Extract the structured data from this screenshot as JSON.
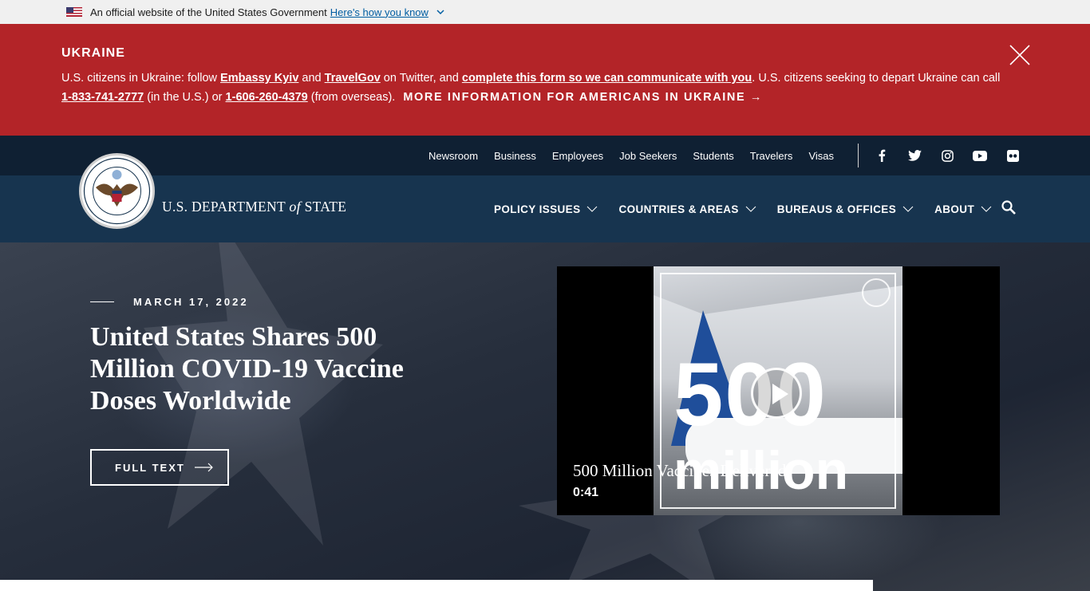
{
  "gov_banner": {
    "text": "An official website of the United States Government",
    "link": "Here's how you know"
  },
  "alert": {
    "title": "UKRAINE",
    "line_parts": {
      "p1": "U.S. citizens in Ukraine: follow ",
      "embassy": "Embassy Kyiv",
      "p2": " and ",
      "travelgov": "TravelGov",
      "p3": " on Twitter, and ",
      "form": "complete this form so we can communicate with you",
      "p4": ". U.S. citizens seeking to depart Ukraine can call ",
      "phone_us": "1-833-741-2777",
      "p5": " (in the U.S.) or ",
      "phone_overseas": "1-606-260-4379",
      "p6": " (from overseas).",
      "more": "MORE INFORMATION FOR AMERICANS IN UKRAINE →"
    }
  },
  "utility_nav": [
    "Newsroom",
    "Business",
    "Employees",
    "Job Seekers",
    "Students",
    "Travelers",
    "Visas"
  ],
  "brand": {
    "pre": "U.S. DEPARTMENT ",
    "of": "of",
    "post": " STATE"
  },
  "main_nav": [
    "POLICY ISSUES",
    "COUNTRIES & AREAS",
    "BUREAUS & OFFICES",
    "ABOUT"
  ],
  "hero": {
    "date": "MARCH 17, 2022",
    "headline": "United States Shares 500 Million COVID-19 Vaccine Doses Worldwide",
    "button": "FULL TEXT"
  },
  "video": {
    "overlay_number": "500",
    "overlay_word": "million",
    "title": "500 Million Vaccines Delivered",
    "duration": "0:41"
  },
  "colors": {
    "alert_red": "#b32428",
    "header_navy": "#17344f",
    "utility_navy": "#0f2033"
  }
}
